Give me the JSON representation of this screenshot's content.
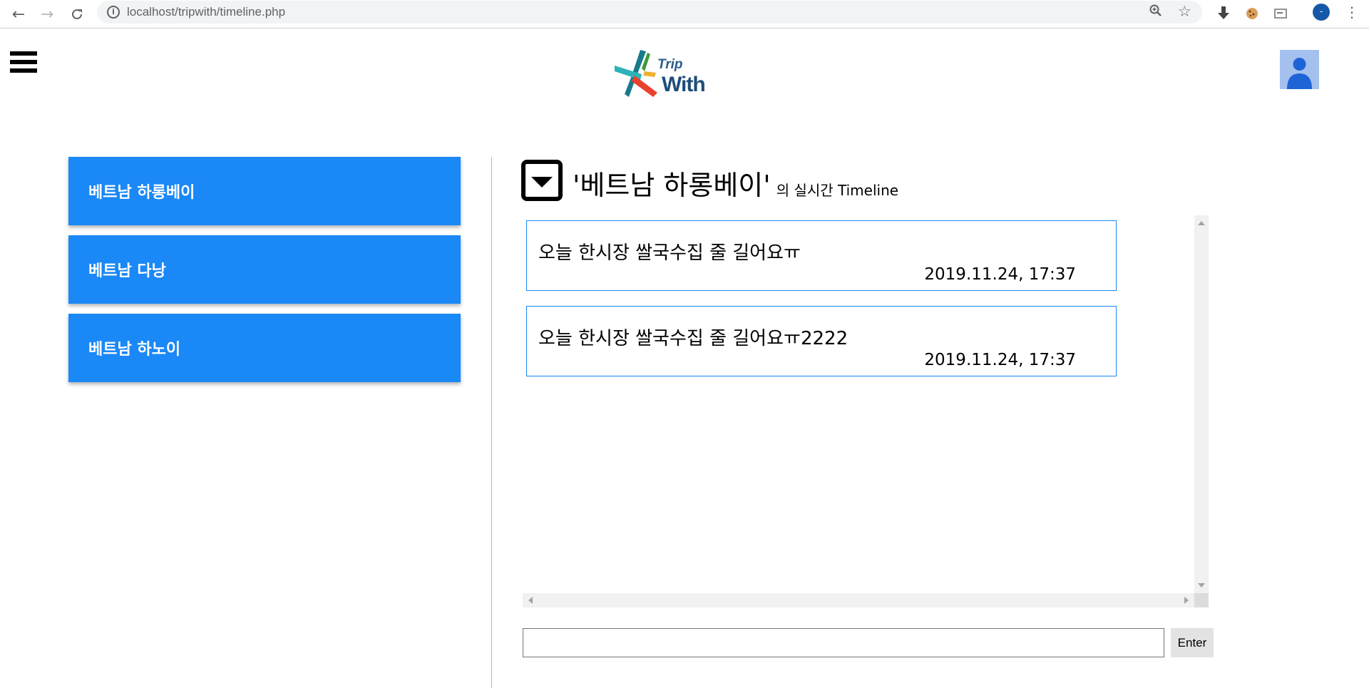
{
  "browser": {
    "url": "localhost/tripwith/timeline.php",
    "profile_initial": "-"
  },
  "header": {
    "logo_text_top": "Trip",
    "logo_text_bottom": "With"
  },
  "places": [
    {
      "label": "베트남 하롱베이"
    },
    {
      "label": "베트남 다낭"
    },
    {
      "label": "베트남 하노이"
    }
  ],
  "timeline": {
    "title": "'베트남 하롱베이'",
    "subtitle": "의 실시간 Timeline",
    "posts": [
      {
        "message": "오늘 한시장 쌀국수집 줄 길어요ㅠ",
        "time": "2019.11.24, 17:37"
      },
      {
        "message": "오늘 한시장 쌀국수집 줄 길어요ㅠ2222",
        "time": "2019.11.24, 17:37"
      }
    ]
  },
  "composer": {
    "input_value": "",
    "button_label": "Enter"
  },
  "colors": {
    "accent": "#1a88f7",
    "avatar_bg": "#a3c0ee"
  }
}
